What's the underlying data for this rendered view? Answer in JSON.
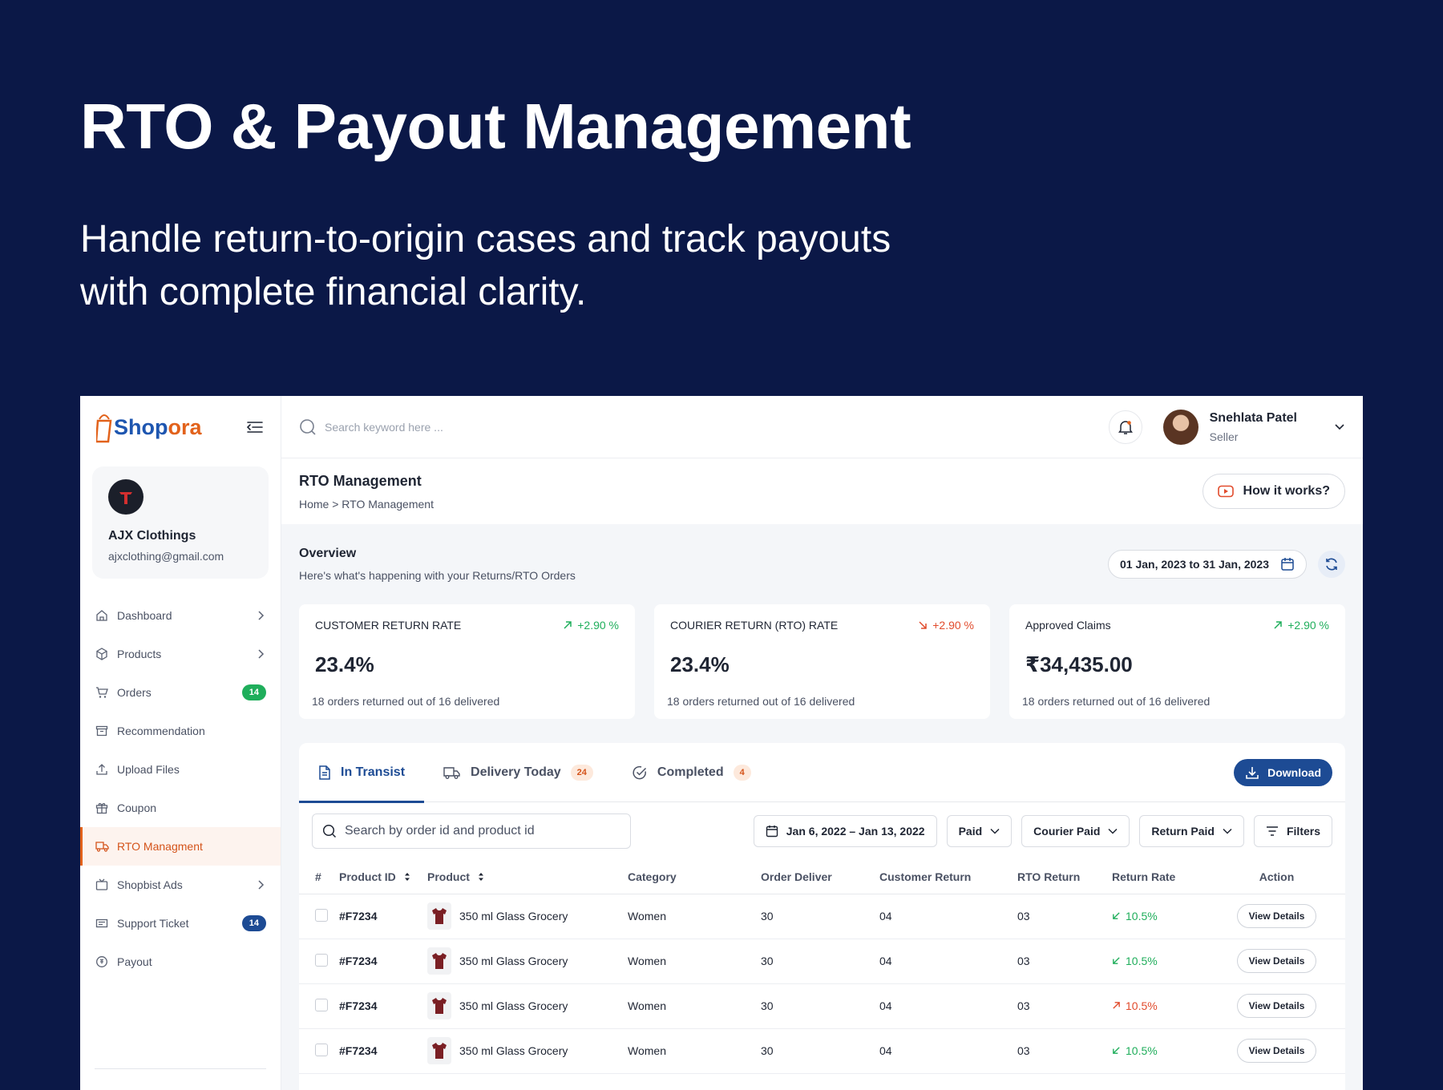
{
  "hero": {
    "title": "RTO & Payout Management",
    "subtitle": "Handle return-to-origin cases and track payouts with complete financial clarity."
  },
  "brand": {
    "name_part1": "Shop",
    "name_part2": "ora",
    "primary_color": "#1e56b0",
    "accent_color": "#e2621b"
  },
  "store": {
    "name": "AJX Clothings",
    "email": "ajxclothing@gmail.com"
  },
  "sidebar": {
    "items": [
      {
        "label": "Dashboard",
        "icon": "home-icon",
        "chevron": true
      },
      {
        "label": "Products",
        "icon": "box-icon",
        "chevron": true
      },
      {
        "label": "Orders",
        "icon": "cart-icon",
        "badge": "14"
      },
      {
        "label": "Recommendation",
        "icon": "archive-icon"
      },
      {
        "label": "Upload Files",
        "icon": "upload-icon"
      },
      {
        "label": "Coupon",
        "icon": "gift-icon"
      },
      {
        "label": "RTO Managment",
        "icon": "truck-icon",
        "active": true
      },
      {
        "label": "Shopbist Ads",
        "icon": "tv-icon",
        "chevron": true
      },
      {
        "label": "Support Ticket",
        "icon": "ticket-icon",
        "badge": "14"
      },
      {
        "label": "Payout",
        "icon": "coin-icon"
      }
    ]
  },
  "topbar": {
    "search_placeholder": "Search keyword here ...",
    "user_name": "Snehlata Patel",
    "user_role": "Seller"
  },
  "page": {
    "title": "RTO Management",
    "breadcrumb": "Home > RTO Management",
    "how_it_works": "How it works?"
  },
  "overview": {
    "title": "Overview",
    "subtitle": "Here's what's happening with your Returns/RTO Orders",
    "date_range": "01 Jan, 2023 to 31 Jan, 2023"
  },
  "stats": [
    {
      "label": "CUSTOMER RETURN RATE",
      "trend": "+2.90 %",
      "direction": "up",
      "value": "23.4%",
      "foot": "18 orders returned out of 16 delivered"
    },
    {
      "label": "COURIER RETURN (RTO) RATE",
      "trend": "+2.90 %",
      "direction": "down",
      "value": "23.4%",
      "foot": "18 orders returned out of 16 delivered"
    },
    {
      "label": "Approved Claims",
      "trend": "+2.90 %",
      "direction": "up",
      "value": "₹34,435.00",
      "foot": "18 orders returned out of 16 delivered"
    }
  ],
  "tabs": [
    {
      "label": "In Transist",
      "active": true
    },
    {
      "label": "Delivery Today",
      "badge": "24"
    },
    {
      "label": "Completed",
      "badge": "4"
    }
  ],
  "download_label": "Download",
  "filters": {
    "search_placeholder": "Search by order id and product id",
    "date": "Jan 6, 2022 – Jan 13, 2022",
    "paid": "Paid",
    "courier_paid": "Courier Paid",
    "return_paid": "Return Paid",
    "filters_label": "Filters"
  },
  "table": {
    "headers": [
      "#",
      "Product ID",
      "Product",
      "Category",
      "Order Deliver",
      "Customer Return",
      "RTO Return",
      "Return Rate",
      "Action"
    ],
    "rows": [
      {
        "id": "#F7234",
        "product": "350 ml Glass Grocery",
        "category": "Women",
        "order_deliver": "30",
        "customer_return": "04",
        "rto_return": "03",
        "return_rate": "10.5%",
        "rate_dir": "down",
        "action": "View Details"
      },
      {
        "id": "#F7234",
        "product": "350 ml Glass Grocery",
        "category": "Women",
        "order_deliver": "30",
        "customer_return": "04",
        "rto_return": "03",
        "return_rate": "10.5%",
        "rate_dir": "down",
        "action": "View Details"
      },
      {
        "id": "#F7234",
        "product": "350 ml Glass Grocery",
        "category": "Women",
        "order_deliver": "30",
        "customer_return": "04",
        "rto_return": "03",
        "return_rate": "10.5%",
        "rate_dir": "up",
        "action": "View Details"
      },
      {
        "id": "#F7234",
        "product": "350 ml Glass Grocery",
        "category": "Women",
        "order_deliver": "30",
        "customer_return": "04",
        "rto_return": "03",
        "return_rate": "10.5%",
        "rate_dir": "down",
        "action": "View Details"
      }
    ]
  }
}
